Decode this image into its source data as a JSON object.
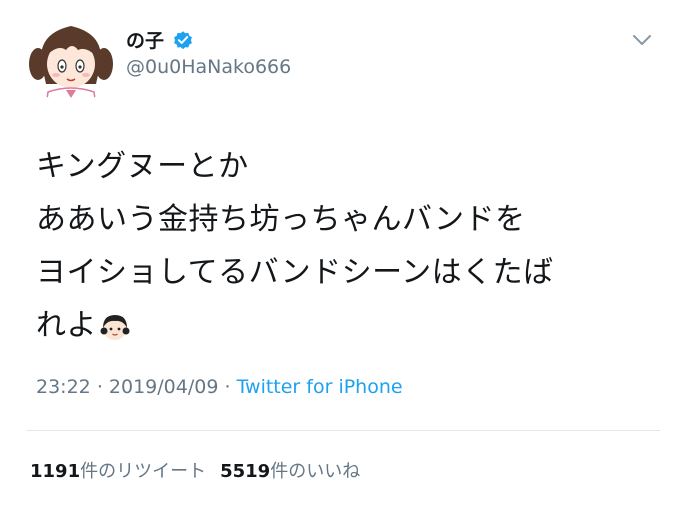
{
  "tweet": {
    "display_name": "の子",
    "handle": "@0u0HaNako666",
    "text_lines": [
      "キングヌーとか",
      "ああいう金持ち坊っちゃんバンドを",
      "ヨイショしてるバンドシーンはくたば",
      "れよ"
    ],
    "emoji_icon": "girl-emoji",
    "time": "23:22",
    "date": "2019/04/09",
    "separator": "·",
    "source": "Twitter for iPhone",
    "retweet_count": "1191",
    "retweet_label": "件のリツイート",
    "like_count": "5519",
    "like_label": "件のいいね"
  },
  "colors": {
    "link": "#1da1f2",
    "muted": "#657786",
    "text": "#14171a",
    "verified": "#1da1f2"
  },
  "icons": {
    "avatar": "anime-girl-avatar",
    "verified": "verified-badge-icon",
    "menu": "chevron-down-icon"
  }
}
